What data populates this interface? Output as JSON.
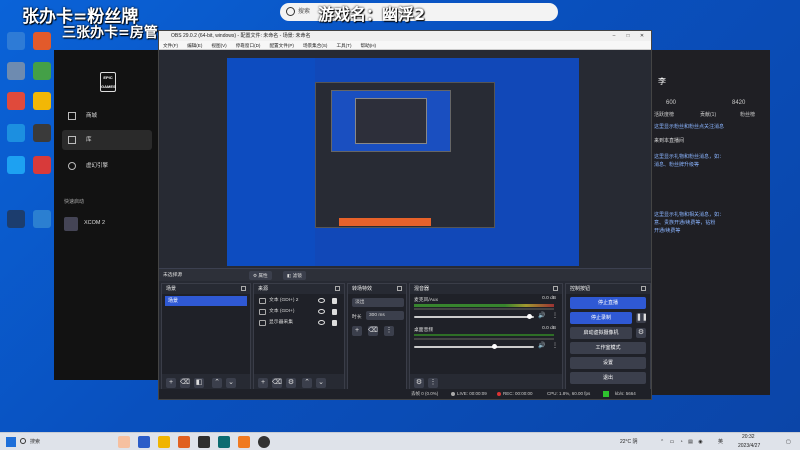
{
  "overlay": {
    "line1": "张办卡=粉丝牌",
    "line2": "三张办卡=房管",
    "game_name": "游戏名：幽浮2"
  },
  "search": {
    "placeholder": "搜索"
  },
  "desktop_icons": [
    {
      "label": "",
      "color": "#2e7bd6"
    },
    {
      "label": "",
      "color": "#e25a2b"
    },
    {
      "label": "",
      "color": "#6e8bb0"
    },
    {
      "label": "",
      "color": "#44a047"
    },
    {
      "label": "",
      "color": "#e04a3b"
    },
    {
      "label": "",
      "color": "#f2b705"
    },
    {
      "label": "",
      "color": "#1c8fe0"
    },
    {
      "label": "",
      "color": "#3a3a3a"
    },
    {
      "label": "",
      "color": "#1da1f2"
    },
    {
      "label": "",
      "color": "#d83a3a"
    },
    {
      "label": "",
      "color": "#1c3d6e"
    },
    {
      "label": "",
      "color": "#2b7fd1"
    }
  ],
  "epic": {
    "logo": "EPIC GAMES",
    "nav": [
      {
        "label": "商城",
        "icon": "tag-icon"
      },
      {
        "label": "库",
        "icon": "grid-icon"
      },
      {
        "label": "虚幻引擎",
        "icon": "unreal-icon"
      }
    ],
    "quick_label": "快速启动",
    "game": "XCOM 2"
  },
  "stream_panel": {
    "stats": [
      "600",
      "8420"
    ],
    "title": "李",
    "lines": [
      "活跃度榜",
      "贡献(1)",
      "粉丝榜",
      "这里显示粉丝和粉丝点关注消息",
      "来到本直播间",
      "这里显示礼物和粉丝消息，如：",
      "消息、粉丝牌升级等",
      "这里显示礼物和相关消息，如：",
      "意、贵族开通/续费等，钻粉",
      "开通/续费等"
    ]
  },
  "obs": {
    "title": "OBS 29.0.2 (64-bit, windows) - 配置文件: 未命名 - 场景: 未命名",
    "menu": [
      "文件(F)",
      "编辑(E)",
      "视图(V)",
      "停靠窗口(D)",
      "配置文件(P)",
      "场景集合(S)",
      "工具(T)",
      "帮助(H)"
    ],
    "no_source": "未选择源",
    "props_btn": "属性",
    "filters_btn": "滤镜",
    "scenes": {
      "title": "场景",
      "items": [
        "场景"
      ]
    },
    "sources": {
      "title": "来源",
      "items": [
        "文本 (GDI+) 2",
        "文本 (GDI+)",
        "显示器采集"
      ]
    },
    "transitions": {
      "title": "转场特效",
      "type": "淡出",
      "duration_label": "时长",
      "duration": "300 ms"
    },
    "mixer": {
      "title": "混音器",
      "tracks": [
        {
          "name": "麦克风/Aux",
          "db": "0.0 dB",
          "level": 0.96
        },
        {
          "name": "桌面音频",
          "db": "0.0 dB",
          "level": 0.67
        }
      ]
    },
    "controls": {
      "title": "控制按钮",
      "buttons": [
        "停止直播",
        "停止录制",
        "启动虚拟摄像机",
        "工作室模式",
        "设置",
        "退出"
      ]
    },
    "status": {
      "dropped": "丢帧 0 (0.0%)",
      "live": "LIVE: 00:00:09",
      "rec": "REC: 00:00:00",
      "cpu": "CPU: 1.8%, 60.00 fps",
      "kbps": "kb/s: 5664"
    }
  },
  "taskbar": {
    "search": "搜索",
    "weather": "22°C 阴",
    "time": "20:32",
    "date": "2023/4/27",
    "lang": "英"
  },
  "colors": {
    "accent": "#2f59d4",
    "desktop": "#0b57c9"
  }
}
